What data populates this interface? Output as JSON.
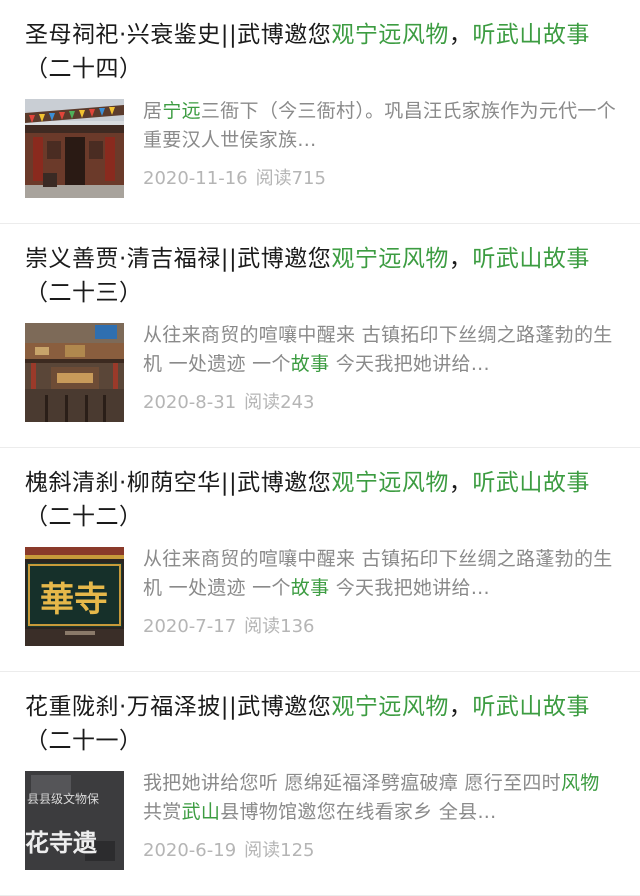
{
  "articles": [
    {
      "title_parts": [
        {
          "text": "圣母祠祀·兴衰鉴史||武博邀您",
          "hl": false
        },
        {
          "text": "观宁远风物",
          "hl": true
        },
        {
          "text": "，",
          "hl": false
        },
        {
          "text": "听武山故事",
          "hl": true
        },
        {
          "text": "（二十四）",
          "hl": false
        }
      ],
      "desc_parts": [
        {
          "text": "居",
          "hl": false
        },
        {
          "text": "宁远",
          "hl": true
        },
        {
          "text": "三衙下（今三衙村）。巩昌汪氏家族作为元代一个重要汉人世侯家族...",
          "hl": false
        }
      ],
      "date": "2020-11-16",
      "reads": "阅读715",
      "thumb": "temple-gate"
    },
    {
      "title_parts": [
        {
          "text": "崇义善贾·清吉福禄||武博邀您",
          "hl": false
        },
        {
          "text": "观宁远风物",
          "hl": true
        },
        {
          "text": "，",
          "hl": false
        },
        {
          "text": "听武山故事",
          "hl": true
        },
        {
          "text": "（二十三）",
          "hl": false
        }
      ],
      "desc_parts": [
        {
          "text": "从往来商贸的喧嚷中醒来 古镇拓印下丝绸之路蓬勃的生机 一处遗迹 一个",
          "hl": false
        },
        {
          "text": "故事",
          "hl": true
        },
        {
          "text": " 今天我把她讲给...",
          "hl": false
        }
      ],
      "date": "2020-8-31",
      "reads": "阅读243",
      "thumb": "carved-hall"
    },
    {
      "title_parts": [
        {
          "text": "槐斜清刹·柳荫空华||武博邀您",
          "hl": false
        },
        {
          "text": "观宁远风物",
          "hl": true
        },
        {
          "text": "，",
          "hl": false
        },
        {
          "text": "听武山故事",
          "hl": true
        },
        {
          "text": "（二十二）",
          "hl": false
        }
      ],
      "desc_parts": [
        {
          "text": "从往来商贸的喧嚷中醒来 古镇拓印下丝绸之路蓬勃的生机 一处遗迹 一个",
          "hl": false
        },
        {
          "text": "故事",
          "hl": true
        },
        {
          "text": " 今天我把她讲给...",
          "hl": false
        }
      ],
      "date": "2020-7-17",
      "reads": "阅读136",
      "thumb": "gold-plaque",
      "thumb_text": "華寺"
    },
    {
      "title_parts": [
        {
          "text": "花重陇刹·万福泽披||武博邀您",
          "hl": false
        },
        {
          "text": "观宁远风物",
          "hl": true
        },
        {
          "text": "，",
          "hl": false
        },
        {
          "text": "听武山故事",
          "hl": true
        },
        {
          "text": "（二十一）",
          "hl": false
        }
      ],
      "desc_parts": [
        {
          "text": "我把她讲给您听 愿绵延福泽劈瘟破瘴 愿行至四时",
          "hl": false
        },
        {
          "text": "风物",
          "hl": true
        },
        {
          "text": "共赏",
          "hl": false
        },
        {
          "text": "武山",
          "hl": true
        },
        {
          "text": "县博物馆邀您在线看家乡 全县...",
          "hl": false
        }
      ],
      "date": "2020-6-19",
      "reads": "阅读125",
      "thumb": "stone-stele",
      "thumb_text_top": "县县级文物保",
      "thumb_text_bottom": "花寺遗"
    }
  ],
  "colors": {
    "highlight": "#3c9c41",
    "title": "#1a1a1a",
    "desc": "#8a8a8a",
    "meta": "#b5b5b5"
  }
}
